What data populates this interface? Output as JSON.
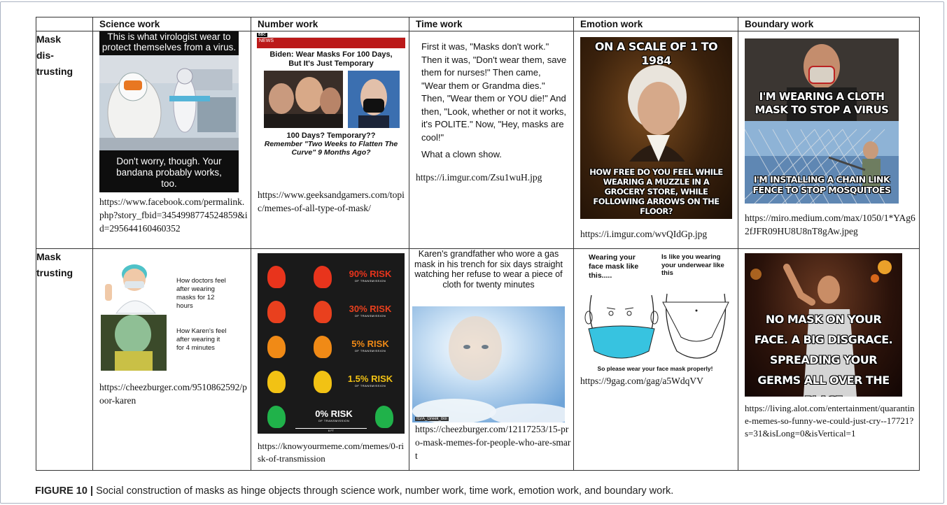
{
  "columns": [
    "Science work",
    "Number work",
    "Time work",
    "Emotion work",
    "Boundary work"
  ],
  "rows": [
    {
      "label": "Mask dis-trusting",
      "cells": [
        {
          "meme_top": "This is what virologist wear to protect themselves from a virus.",
          "meme_bottom": "Don't worry, though. Your bandana probably works, too.",
          "url": "https://www.facebook.com/permalink.php?story_fbid=3454998774524859&id=295644160460352"
        },
        {
          "banner": "NEWS",
          "headline": "Biden: Wear Masks For 100 Days, But It's Just Temporary",
          "line1": "100 Days? Temporary??",
          "line2": "Remember \"Two Weeks to Flatten The Curve\" 9 Months Ago?",
          "url": "https://www.geeksandgamers.com/topic/memes-of-all-type-of-mask/"
        },
        {
          "para1": "First it was, \"Masks don't work.\" Then it was, \"Don't wear them, save them for nurses!\" Then came, \"Wear them or Grandma dies.\" Then, \"Wear them or YOU die!\" And then, \"Look, whether or not it works, it's POLITE.\" Now, \"Hey, masks are cool!\"",
          "para2": "What a clown show.",
          "url": "https://i.imgur.com/Zsu1wuH.jpg"
        },
        {
          "meme_top": "ON A SCALE OF 1 TO 1984",
          "meme_bottom": "HOW FREE DO YOU FEEL WHILE WEARING A MUZZLE IN A GROCERY STORE, WHILE FOLLOWING ARROWS ON THE FLOOR?",
          "url": "https://i.imgur.com/wvQIdGp.jpg"
        },
        {
          "meme_top": "I'M WEARING A CLOTH MASK TO STOP A VIRUS",
          "meme_bottom": "I'M INSTALLING A CHAIN LINK FENCE TO STOP MOSQUITOES",
          "url": "https://miro.medium.com/max/1050/1*YAg62fJFR09HU8U8nT8gAw.jpeg"
        }
      ]
    },
    {
      "label": "Mask trusting",
      "cells": [
        {
          "text1": "How doctors feel after wearing masks for 12 hours",
          "text2": "How Karen's feel after wearing it for 4 minutes",
          "url": "https://cheezburger.com/9510862592/poor-karen"
        },
        {
          "risks": [
            "90% RISK",
            "30% RISK",
            "5% RISK",
            "1.5% RISK",
            "0% RISK"
          ],
          "risk_sub": "OF TRANSMISSION",
          "distance": "6 FT",
          "url": "https://knowyourmeme.com/memes/0-risk-of-transmission"
        },
        {
          "meme_top": "Karen's grandfather who wore a gas mask in his trench for six days straight watching her refuse to wear a piece of cloth for twenty minutes",
          "watermark": "IG/A_Greek_Boi",
          "url": "https://cheezburger.com/12117253/15-pro-mask-memes-for-people-who-are-smart"
        },
        {
          "left_label": "Wearing your face mask like this.....",
          "right_label": "Is like you wearing your underwear like this",
          "bottom": "So please wear your face mask properly!",
          "url": "https://9gag.com/gag/a5WdqVV"
        },
        {
          "meme_text": "NO MASK ON YOUR FACE. A BIG DISGRACE. SPREADING YOUR GERMS ALL OVER THE PLACE",
          "url": "https://living.alot.com/entertainment/quarantine-memes-so-funny-we-could-just-cry--17721?s=31&isLong=0&isVertical=1"
        }
      ]
    }
  ],
  "caption": {
    "label": "FIGURE 10 |",
    "text": "Social construction of masks as hinge objects through science work, number work, time work, emotion work, and boundary work."
  },
  "colors": {
    "risk": [
      "#e8341c",
      "#e9401e",
      "#f08a16",
      "#f2c214",
      "#20b24a"
    ],
    "mask_blue": "#37c3e0"
  }
}
